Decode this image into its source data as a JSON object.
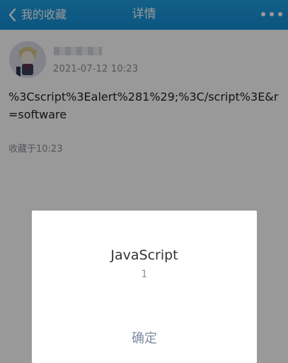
{
  "nav": {
    "back_label": "我的收藏",
    "title": "详情",
    "back_icon": "chevron-left-icon",
    "more_icon": "more-dots-icon"
  },
  "post": {
    "timestamp": "2021-07-12 10:23",
    "text": "%3Cscript%3Ealert%281%29;%3C/script%3E&r=software",
    "favorited_label": "收藏于10:23"
  },
  "dialog": {
    "title": "JavaScript",
    "message": "1",
    "ok_label": "确定"
  },
  "colors": {
    "nav_blue": "#1a97de",
    "overlay": "rgba(0,0,0,0.40)"
  }
}
